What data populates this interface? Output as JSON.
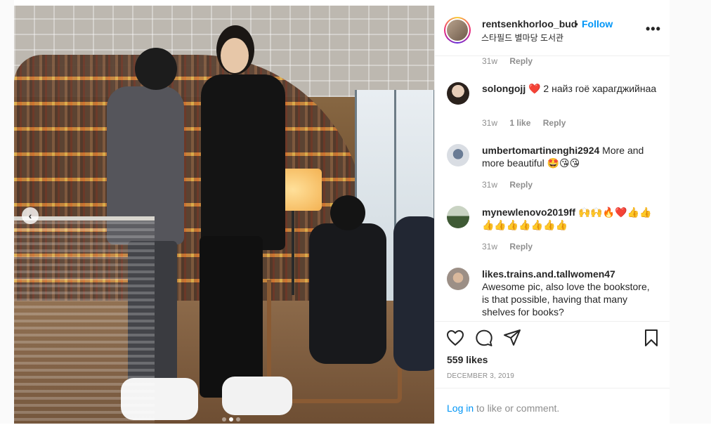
{
  "post": {
    "carousel_prev_icon": "chevron-left-icon",
    "carousel_prev_glyph": "‹"
  },
  "header": {
    "username": "rentsenkhorloo_bud",
    "dot": "•",
    "follow_label": "Follow",
    "location": "스타필드 별마당 도서관",
    "more_glyph": "•••"
  },
  "comments": [
    {
      "username": "",
      "text": "",
      "time": "31w",
      "likes": "",
      "reply_label": "Reply"
    },
    {
      "username": "solongojj",
      "text": " 2 найз гоё харагджийнаа",
      "emoji_prefix": "❤️",
      "time": "31w",
      "likes": "1 like",
      "reply_label": "Reply"
    },
    {
      "username": "umbertomartinenghi2924",
      "text": " More and more beautiful 🤩😘😘",
      "time": "31w",
      "likes": "",
      "reply_label": "Reply"
    },
    {
      "username": "mynewlenovo2019ff",
      "text": " 🙌🙌🔥❤️👍👍👍👍👍👍👍👍👍",
      "time": "31w",
      "likes": "",
      "reply_label": "Reply"
    },
    {
      "username": "likes.trains.and.tallwomen47",
      "text": "Awesome pic, also love the bookstore, is that possible, having that many shelves for books?",
      "time": "",
      "likes": "",
      "reply_label": ""
    }
  ],
  "actions": {
    "likes": "559 likes",
    "date": "DECEMBER 3, 2019",
    "login_link": "Log in",
    "login_rest": " to like or comment."
  },
  "icons": {
    "like": "heart-icon",
    "comment": "comment-icon",
    "share": "send-icon",
    "save": "bookmark-icon",
    "more": "more-options-icon"
  },
  "colors": {
    "link_blue": "#0095f6",
    "muted_text": "#8e8e8e",
    "text": "#262626",
    "heart_red": "#ed4956"
  }
}
